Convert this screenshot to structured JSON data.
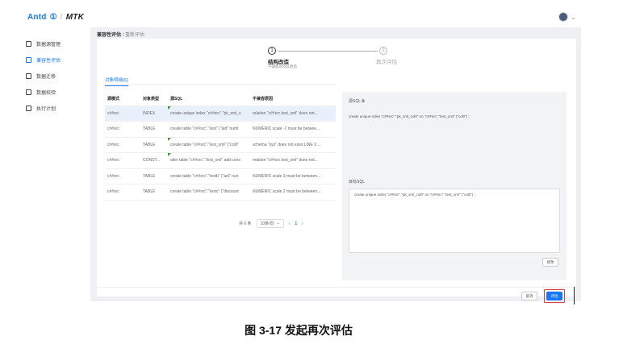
{
  "header": {
    "logo": "Antd",
    "logo_mark": "①",
    "separator": "/",
    "product": "MTK"
  },
  "sidebar": {
    "items": [
      {
        "label": "数据源管理",
        "icon": "database-icon",
        "active": false
      },
      {
        "label": "兼容性评估",
        "icon": "evaluate-icon",
        "active": true
      },
      {
        "label": "数据迁移",
        "icon": "migrate-icon",
        "active": false
      },
      {
        "label": "数据校验",
        "icon": "verify-icon",
        "active": false
      },
      {
        "label": "执行计划",
        "icon": "plan-icon",
        "active": false
      }
    ]
  },
  "breadcrumb": {
    "parent": "兼容性评估",
    "separator": "/",
    "current": "重新评估"
  },
  "steps": [
    {
      "index": "1",
      "title": "结构改造",
      "desc": "不兼容的SQL改造"
    },
    {
      "index": "2",
      "title": "再次评估"
    }
  ],
  "tab": {
    "label": "对象明细(6)"
  },
  "table": {
    "columns": [
      "源模式",
      "对象类型",
      "源SQL",
      "不兼容原因"
    ],
    "rows": [
      {
        "schema": "c##src",
        "type": "INDEX",
        "sql": "create unique index \"c##src\".\"pk_xml_c",
        "reason": "relation \"c##src.test_xml\" does not...",
        "flag": true,
        "selected": true
      },
      {
        "schema": "c##src",
        "type": "TABLE",
        "sql": "create table \"c##src\".\"test\" (\"aid\" numt",
        "reason": "NUMERIC scale -1 must be betwee...",
        "flag": false,
        "selected": false
      },
      {
        "schema": "c##src",
        "type": "TABLE",
        "sql": "create table \"c##src\".\"test_xml\" (\"col0\"",
        "reason": "schema \"sys\" does not exist LINE 1:...",
        "flag": true,
        "selected": false
      },
      {
        "schema": "c##src",
        "type": "CONST...",
        "sql": "alter table \"c##src\".\"test_xml\" add cons",
        "reason": "relation \"c##src.test_xml\" does not...",
        "flag": true,
        "selected": false
      },
      {
        "schema": "c##src",
        "type": "TABLE",
        "sql": "create table \"c##src\".\"testb\" (\"aid\" nun",
        "reason": "NUMERIC scale 3 must be between...",
        "flag": false,
        "selected": false
      },
      {
        "schema": "c##src",
        "type": "TABLE",
        "sql": "create table \"c##src\".\"testc\" (\"discount",
        "reason": "NUMERIC scale 2 must be between...",
        "flag": false,
        "selected": false
      }
    ]
  },
  "pagination": {
    "total": "共 6 条",
    "page_size": "10条/页",
    "prev": "‹",
    "current": "1",
    "next": "›"
  },
  "source_sql": {
    "label": "源SQL",
    "text": "create unique index \"c##src\".\"pk_xml_col0\" on \"c##src\".\"test_xml\" (\"col0\") ;"
  },
  "target_sql": {
    "label": "目标SQL",
    "text": "create unique index \"c##src\".\"pk_xml_col0\" on \"c##src\".\"test_xml\" (\"col0\") ;"
  },
  "buttons": {
    "fix": "修改",
    "cancel": "取消",
    "evaluate": "评估"
  },
  "caption": "图 3-17  发起再次评估",
  "colors": {
    "accent": "#1677ff",
    "highlight_box": "#e23d3d",
    "modified_flag": "#3a9a3a"
  }
}
